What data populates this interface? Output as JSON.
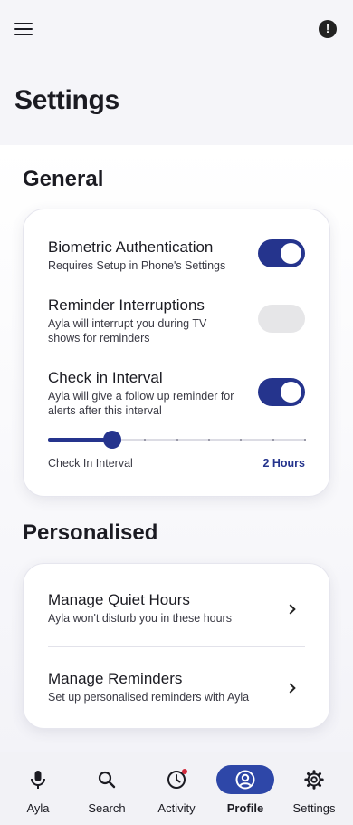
{
  "header": {
    "menu_icon": "menu-icon",
    "info_icon": "alert-circle-icon",
    "info_glyph": "!",
    "title": "Settings"
  },
  "general": {
    "title": "General",
    "settings": [
      {
        "title": "Biometric Authentication",
        "description": "Requires Setup in Phone's Settings",
        "enabled": true
      },
      {
        "title": "Reminder Interruptions",
        "description": "Ayla will interrupt you during TV shows for reminders",
        "enabled": false
      },
      {
        "title": "Check in Interval",
        "description": "Ayla will give a follow up reminder for alerts after this interval",
        "enabled": true
      }
    ],
    "slider": {
      "label": "Check In Interval",
      "value_text": "2 Hours",
      "fraction": 0.25,
      "steps": 8
    }
  },
  "personalised": {
    "title": "Personalised",
    "items": [
      {
        "title": "Manage Quiet Hours",
        "description": "Ayla won't disturb you in these hours"
      },
      {
        "title": "Manage Reminders",
        "description": "Set up personalised reminders with Ayla"
      }
    ]
  },
  "bottom_nav": {
    "tabs": [
      {
        "label": "Ayla",
        "icon": "microphone-icon",
        "active": false
      },
      {
        "label": "Search",
        "icon": "search-icon",
        "active": false
      },
      {
        "label": "Activity",
        "icon": "clock-icon",
        "active": false,
        "badge": true
      },
      {
        "label": "Profile",
        "icon": "user-circle-icon",
        "active": true
      },
      {
        "label": "Settings",
        "icon": "gear-icon",
        "active": false
      }
    ]
  },
  "colors": {
    "accent": "#25348d",
    "active_tab": "#2e47a8",
    "badge": "#d22a3c"
  }
}
